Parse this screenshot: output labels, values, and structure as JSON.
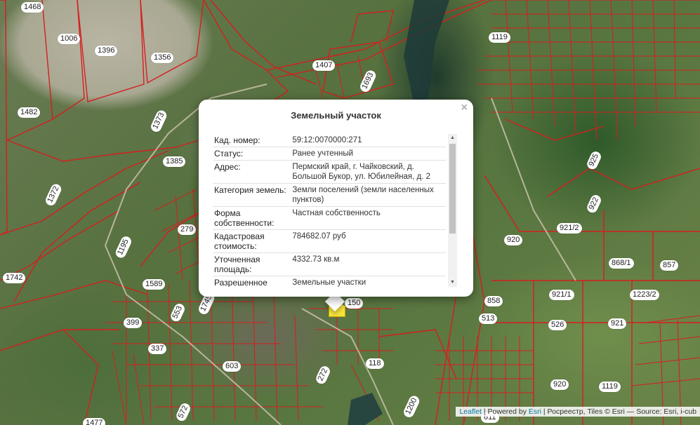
{
  "map": {
    "parcel_labels": [
      "1468",
      "1006",
      "1396",
      "1356",
      "1482",
      "1407",
      "1693",
      "1119",
      "1373",
      "1385",
      "1372",
      "279",
      "1195",
      "1742",
      "1589",
      "553",
      "1745",
      "399",
      "337",
      "603",
      "272",
      "118",
      "150",
      "572",
      "1477",
      "1200",
      "611",
      "920",
      "922",
      "925",
      "921/2",
      "868/1",
      "857",
      "921/1",
      "1223/2",
      "858",
      "513",
      "526",
      "921",
      "920",
      "1119"
    ]
  },
  "popup": {
    "title": "Земельный участок",
    "close_label": "×",
    "rows": [
      {
        "key": "Кад. номер:",
        "value": "59:12:0070000:271"
      },
      {
        "key": "Статус:",
        "value": "Ранее учтенный"
      },
      {
        "key": "Адрес:",
        "value": "Пермский край, г. Чайковский, д. Большой Букор, ул. Юбилейная, д. 2"
      },
      {
        "key": "Категория земель:",
        "value": "Земли поселений (земли населенных пунктов)"
      },
      {
        "key": "Форма собственности:",
        "value": "Частная собственность"
      },
      {
        "key": "Кадастровая стоимость:",
        "value": "784682.07 руб"
      },
      {
        "key": "Уточненная площадь:",
        "value": "4332.73 кв.м"
      },
      {
        "key": "Разрешенное",
        "value": "Земельные участки"
      }
    ]
  },
  "attribution": {
    "leaflet_label": "Leaflet",
    "powered_text": " | Powered by ",
    "esri_label": "Esri",
    "rest_text": " | Росреестр, Tiles © Esri — Source: Esri, i-cub"
  },
  "colors": {
    "parcel_line": "#d41f1f",
    "marker": "#f6e33a",
    "link": "#0078a8"
  }
}
